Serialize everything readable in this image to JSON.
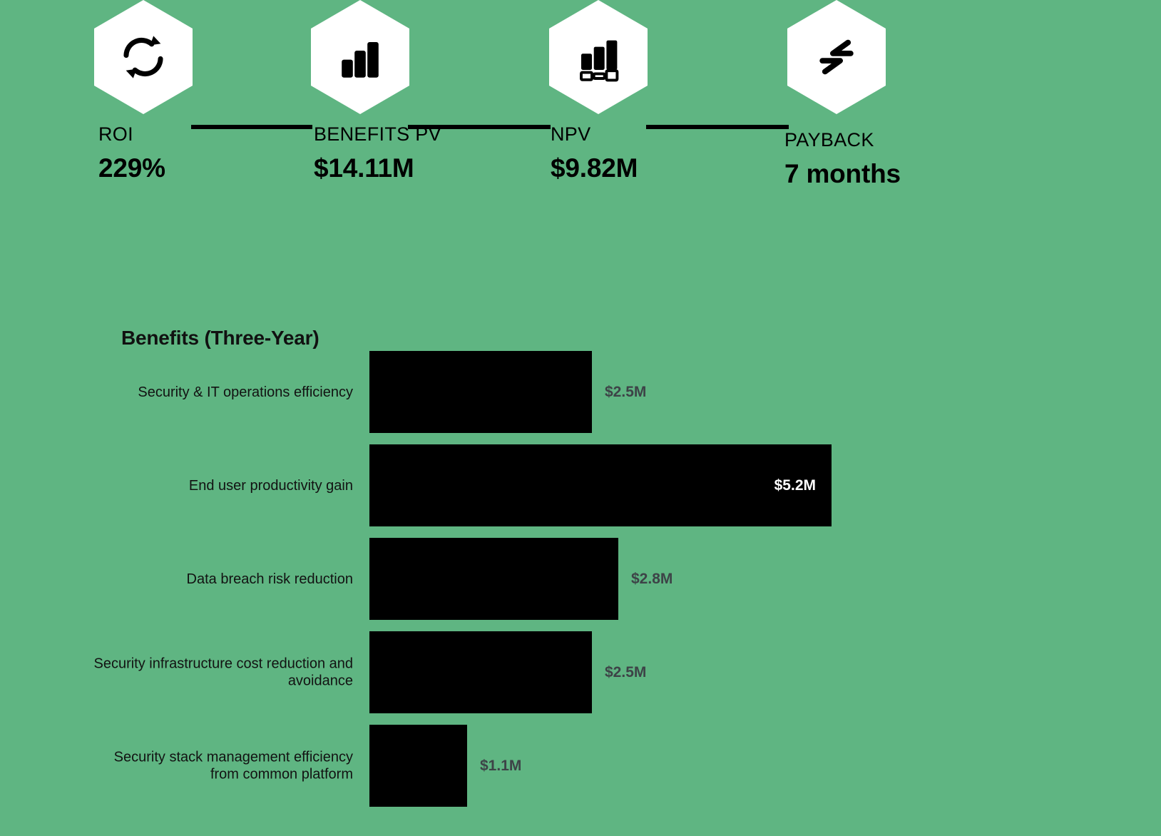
{
  "theme": {
    "background": "#5fb582",
    "bar_color": "#000000",
    "hexagon_fill": "#ffffff",
    "value_label_color": "#3d4347",
    "inside_label_color": "#ffffff",
    "text_color": "#000000"
  },
  "kpis": [
    {
      "icon": "refresh-cycle-icon",
      "label": "ROI",
      "value": "229%"
    },
    {
      "icon": "bar-chart-icon",
      "label": "BENEFITS PV",
      "value": "$14.11M"
    },
    {
      "icon": "bar-chart-legend-icon",
      "label": "NPV",
      "value": "$9.82M"
    },
    {
      "icon": "transfer-arrows-icon",
      "label": "PAYBACK",
      "value": "7 months"
    }
  ],
  "chart_data": {
    "type": "bar",
    "orientation": "horizontal",
    "title": "Benefits (Three-Year)",
    "xlabel": "",
    "ylabel": "",
    "grid": false,
    "legend": "none",
    "unit": "$M",
    "xlim": [
      0,
      5.2
    ],
    "categories": [
      "Security & IT operations efficiency",
      "End user productivity gain",
      "Data breach risk reduction",
      "Security infrastructure cost reduction and avoidance",
      "Security stack management efficiency from common platform"
    ],
    "values": [
      2.5,
      5.2,
      2.8,
      2.5,
      1.1
    ],
    "value_labels": [
      "$2.5M",
      "$5.2M",
      "$2.8M",
      "$2.5M",
      "$1.1M"
    ],
    "label_placement": [
      "outside",
      "inside",
      "outside",
      "outside",
      "outside"
    ]
  }
}
